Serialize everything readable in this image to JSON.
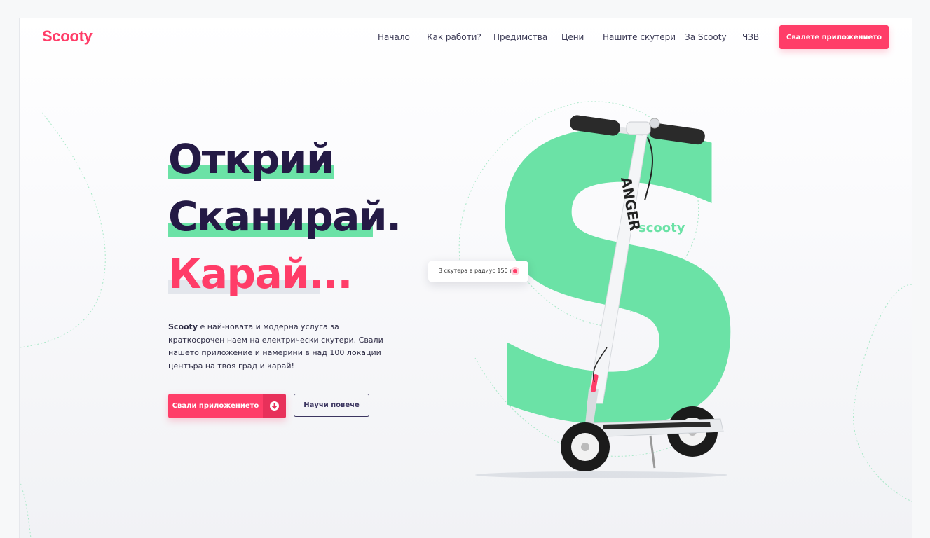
{
  "brand": {
    "logo": "Scooty"
  },
  "nav": {
    "items": [
      {
        "label": "Начало"
      },
      {
        "label": "Как работи?"
      },
      {
        "label": "Предимства"
      },
      {
        "label": "Цени"
      },
      {
        "label": "Нашите скутери"
      },
      {
        "label": "За Scooty"
      },
      {
        "label": "ЧЗВ"
      }
    ],
    "cta_label": "Свалете приложението"
  },
  "hero": {
    "line1": "Открий",
    "line2": "Сканирай.",
    "line3": "Карай...",
    "description_brand": "Scooty",
    "description_rest": " е най-новата и модерна услуга за краткосрочен наем на електрически скутери. Свали нашето приложение и намерини в над 100 локации центъра на твоя град и карай!",
    "primary_button": "Свали приложението",
    "secondary_button": "Научи повече"
  },
  "visual": {
    "popup_text": "3 скутера в радиус 150 m",
    "big_letter": "S",
    "letter_label": "scooty",
    "scooter_brand": "ANGER"
  },
  "colors": {
    "accent": "#ff3d68",
    "green": "#6be2a6",
    "dark": "#241a45"
  }
}
